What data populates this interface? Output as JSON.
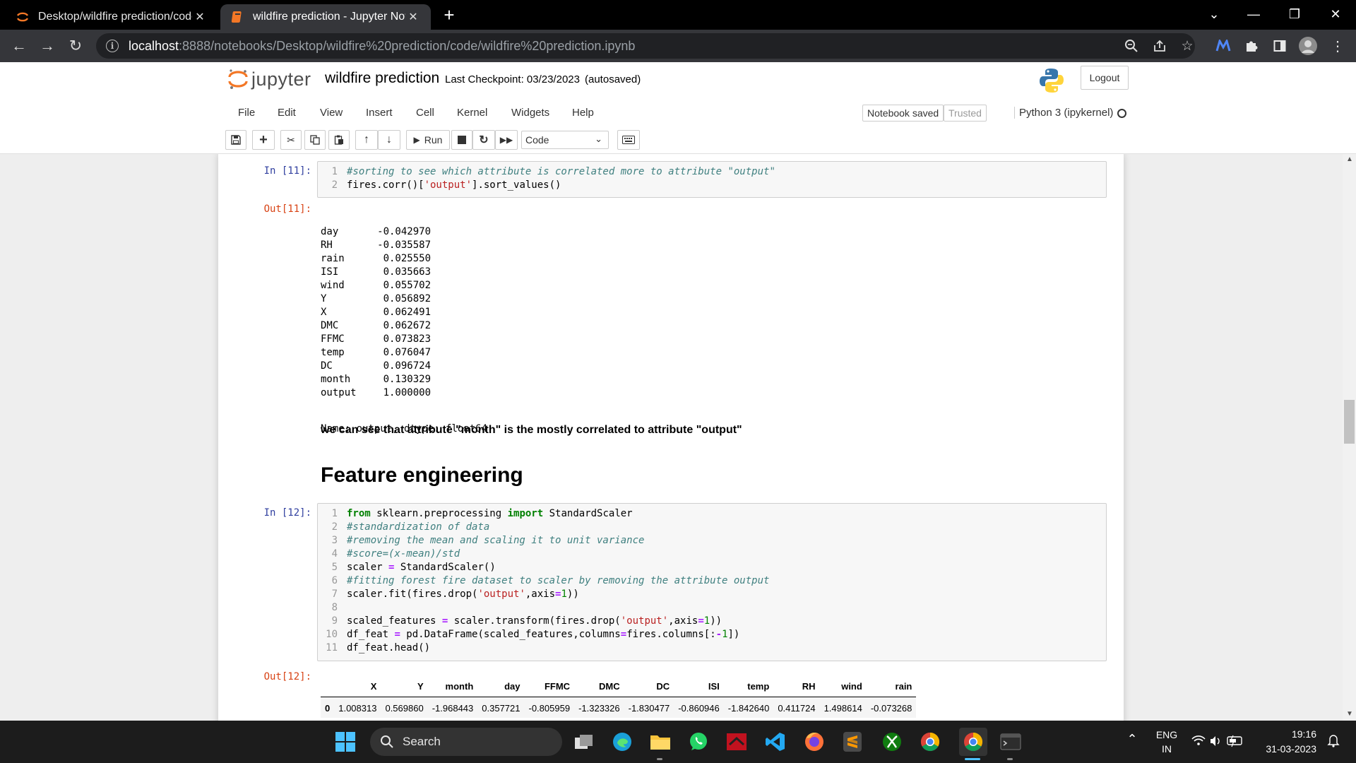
{
  "browser": {
    "tabs": [
      {
        "title": "Desktop/wildfire prediction/code",
        "active": false
      },
      {
        "title": "wildfire prediction - Jupyter Note",
        "active": true
      }
    ],
    "address": {
      "host": "localhost",
      "path": ":8888/notebooks/Desktop/wildfire%20prediction/code/wildfire%20prediction.ipynb"
    }
  },
  "jupyter": {
    "logo_text": "jupyter",
    "notebook_name": "wildfire prediction",
    "checkpoint": "Last Checkpoint: 03/23/2023",
    "autosaved": "(autosaved)",
    "logout_label": "Logout",
    "menu": [
      "File",
      "Edit",
      "View",
      "Insert",
      "Cell",
      "Kernel",
      "Widgets",
      "Help"
    ],
    "notebook_status": "Notebook saved",
    "trusted": "Trusted",
    "kernel": "Python 3 (ipykernel)",
    "run_label": "Run",
    "cell_type": "Code"
  },
  "cells": {
    "in11_prompt": "In [11]:",
    "out11_prompt": "Out[11]:",
    "in12_prompt": "In [12]:",
    "out12_prompt": "Out[12]:",
    "series_output": [
      {
        "key": "day",
        "value": "-0.042970"
      },
      {
        "key": "RH",
        "value": "-0.035587"
      },
      {
        "key": "rain",
        "value": "0.025550"
      },
      {
        "key": "ISI",
        "value": "0.035663"
      },
      {
        "key": "wind",
        "value": "0.055702"
      },
      {
        "key": "Y",
        "value": "0.056892"
      },
      {
        "key": "X",
        "value": "0.062491"
      },
      {
        "key": "DMC",
        "value": "0.062672"
      },
      {
        "key": "FFMC",
        "value": "0.073823"
      },
      {
        "key": "temp",
        "value": "0.076047"
      },
      {
        "key": "DC",
        "value": "0.096724"
      },
      {
        "key": "month",
        "value": "0.130329"
      },
      {
        "key": "output",
        "value": "1.000000"
      }
    ],
    "series_footer": "Name: output, dtype: float64",
    "markdown_text": "we can see that attribute \"month\" is the mostly correlated to attribute \"output\"",
    "markdown_heading": "Feature engineering",
    "dataframe": {
      "columns": [
        "X",
        "Y",
        "month",
        "day",
        "FFMC",
        "DMC",
        "DC",
        "ISI",
        "temp",
        "RH",
        "wind",
        "rain"
      ],
      "rows": [
        {
          "index": "0",
          "values": [
            "1.008313",
            "0.569860",
            "-1.968443",
            "0.357721",
            "-0.805959",
            "-1.323326",
            "-1.830477",
            "-0.860946",
            "-1.842640",
            "0.411724",
            "1.498614",
            "-0.073268"
          ]
        }
      ]
    }
  },
  "taskbar": {
    "search_label": "Search",
    "lang_line1": "ENG",
    "lang_line2": "IN",
    "time": "19:16",
    "date": "31-03-2023"
  }
}
